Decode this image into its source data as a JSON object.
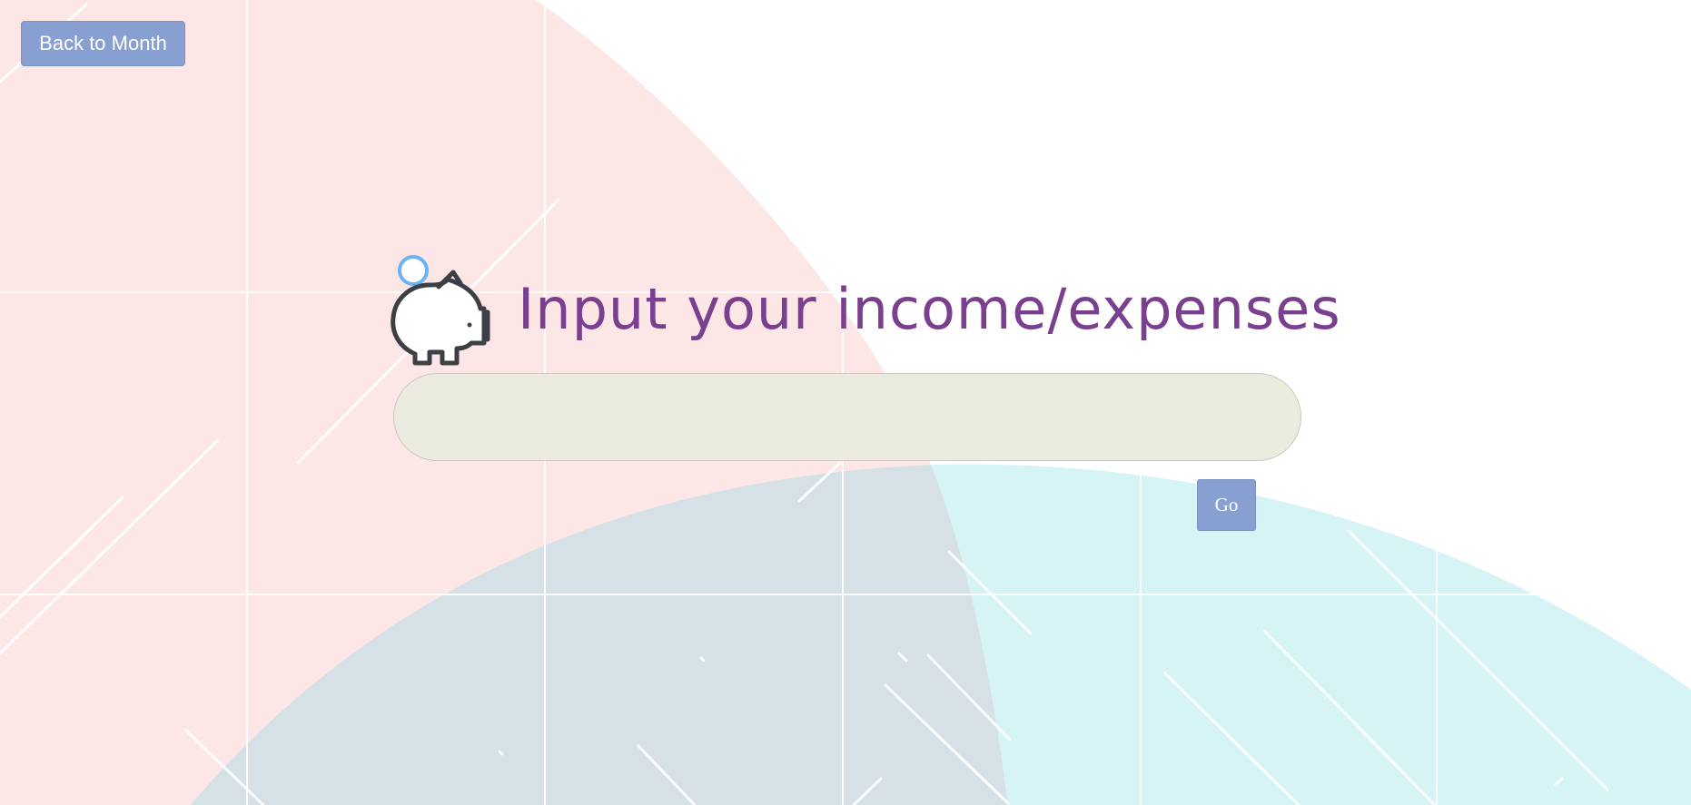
{
  "nav": {
    "back_label": "Back to Month"
  },
  "header": {
    "icon": "piggy-bank-icon",
    "title": "Input your income/expenses"
  },
  "entry": {
    "value": "",
    "placeholder": ""
  },
  "actions": {
    "go_label": "Go"
  },
  "colors": {
    "accent_button": "#87a0d1",
    "title_text": "#7a3f8e",
    "input_background": "#ebebdf",
    "background_pink": "#fde7e6",
    "background_cyan": "#d6f3f6",
    "background_overlap": "#d5e1e6"
  }
}
